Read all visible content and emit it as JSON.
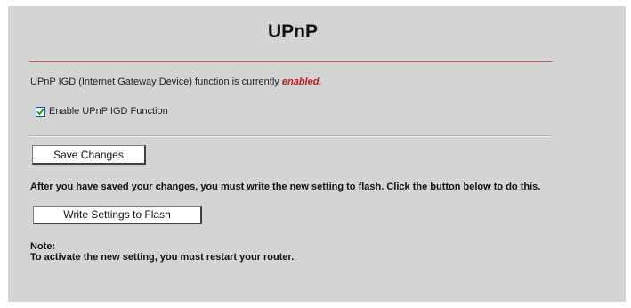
{
  "page": {
    "title": "UPnP",
    "status_prefix": "UPnP IGD (Internet Gateway Device) function is currently ",
    "status_value": "enabled.",
    "enable_checkbox": {
      "label": "Enable UPnP IGD Function",
      "checked": true
    },
    "save_label": "Save Changes",
    "instruction": "After you have saved your changes, you must write the new setting to flash. Click the button below to do this.",
    "flash_label": "Write Settings to Flash",
    "note_label": "Note:",
    "note_text": "To activate the new setting, you must restart your router."
  },
  "colors": {
    "panel_bg": "#d4d4d4",
    "title_rule": "#c05a4f",
    "enabled_text": "#c01818",
    "checkbox_border": "#1c5180",
    "checkmark": "#1e8f2e"
  }
}
